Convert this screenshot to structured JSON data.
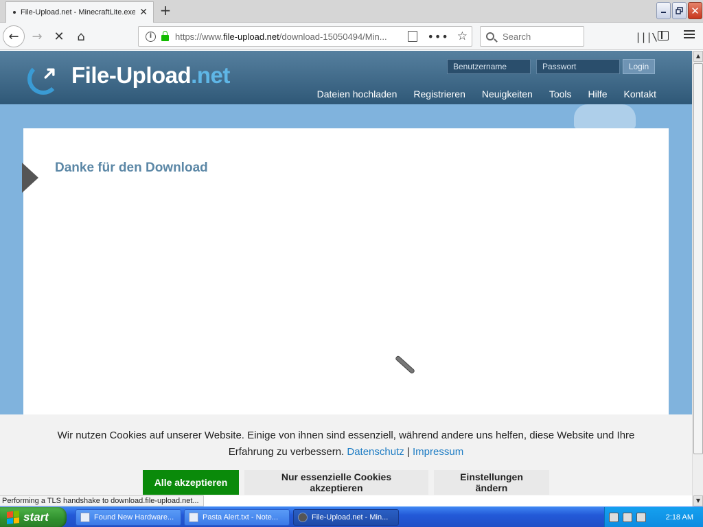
{
  "browser": {
    "tab_title": "File-Upload.net - MinecraftLite.exe",
    "url_domain": "file-upload.net",
    "url_prefix": "https://www.",
    "url_rest": "/download-15050494/Min...",
    "search_placeholder": "Search"
  },
  "site": {
    "logo_name": "File-Upload",
    "logo_tld": ".net",
    "username_placeholder": "Benutzername",
    "password_placeholder": "Passwort",
    "login_label": "Login",
    "nav": [
      "Dateien hochladen",
      "Registrieren",
      "Neuigkeiten",
      "Tools",
      "Hilfe",
      "Kontakt"
    ],
    "heading": "Danke für den Download"
  },
  "cookie_banner": {
    "text": "Wir nutzen Cookies auf unserer Website. Einige von ihnen sind essenziell, während andere uns helfen, diese Website und Ihre Erfahrung zu verbessern.",
    "privacy_link": "Datenschutz",
    "separator": "|",
    "imprint_link": "Impressum",
    "accept_all": "Alle akzeptieren",
    "accept_essential": "Nur essenzielle Cookies akzeptieren",
    "change_settings": "Einstellungen ändern"
  },
  "status_text": "Performing a TLS handshake to download.file-upload.net...",
  "taskbar": {
    "start_label": "start",
    "tasks": [
      "Found New Hardware...",
      "Pasta Alert.txt - Note...",
      "File-Upload.net - Min..."
    ],
    "clock": "2:18 AM"
  },
  "colors": {
    "accept_green": "#0a8a0a",
    "link_blue": "#1f7dc4",
    "heading_blue": "#5b87a6",
    "header_blue": "#2f5877"
  }
}
